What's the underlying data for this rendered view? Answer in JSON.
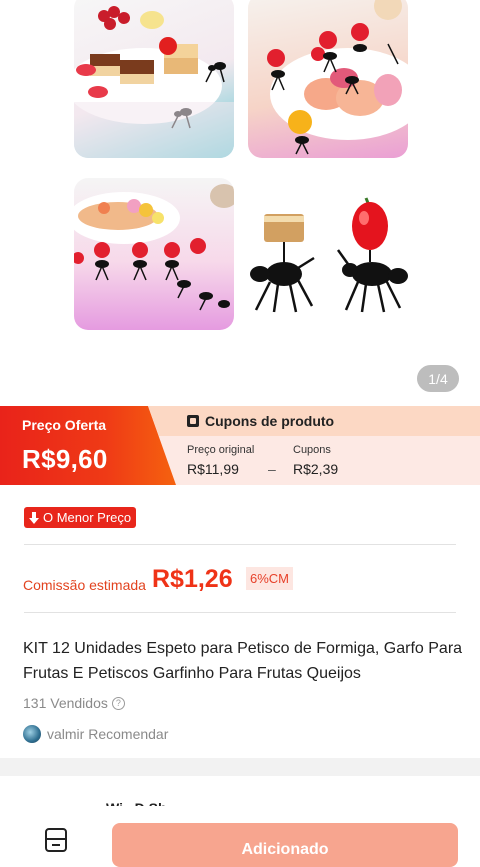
{
  "gallery": {
    "page_indicator": "1/4"
  },
  "price": {
    "offer_label": "Preço Oferta",
    "offer_value": "R$9,60",
    "coupon_header": "Cupons de produto",
    "original_label": "Preço original",
    "original_value": "R$11,99",
    "separator": "–",
    "coupons_label": "Cupons",
    "coupons_value": "R$2,39"
  },
  "badge": {
    "label": "O Menor Preço"
  },
  "commission": {
    "label": "Comissão estimada",
    "value": "R$1,26",
    "rate": "6%CM"
  },
  "product": {
    "title": "KIT 12 Unidades Espeto para Petisco de Formiga, Garfo Para Frutas E Petiscos Garfinho Para Frutas Queijos",
    "sold": "131 Vendidos",
    "help_icon": "?"
  },
  "recommend": {
    "text": "valmir Recomendar"
  },
  "next_section": {
    "peek": "Wi...D Sh..."
  },
  "bottom_bar": {
    "add_button": "Adicionado"
  },
  "colors": {
    "accent_red": "#e9231a",
    "commission_red": "#ef3317",
    "button": "#f7a58f",
    "coupon_bg": "#fde9e4"
  }
}
